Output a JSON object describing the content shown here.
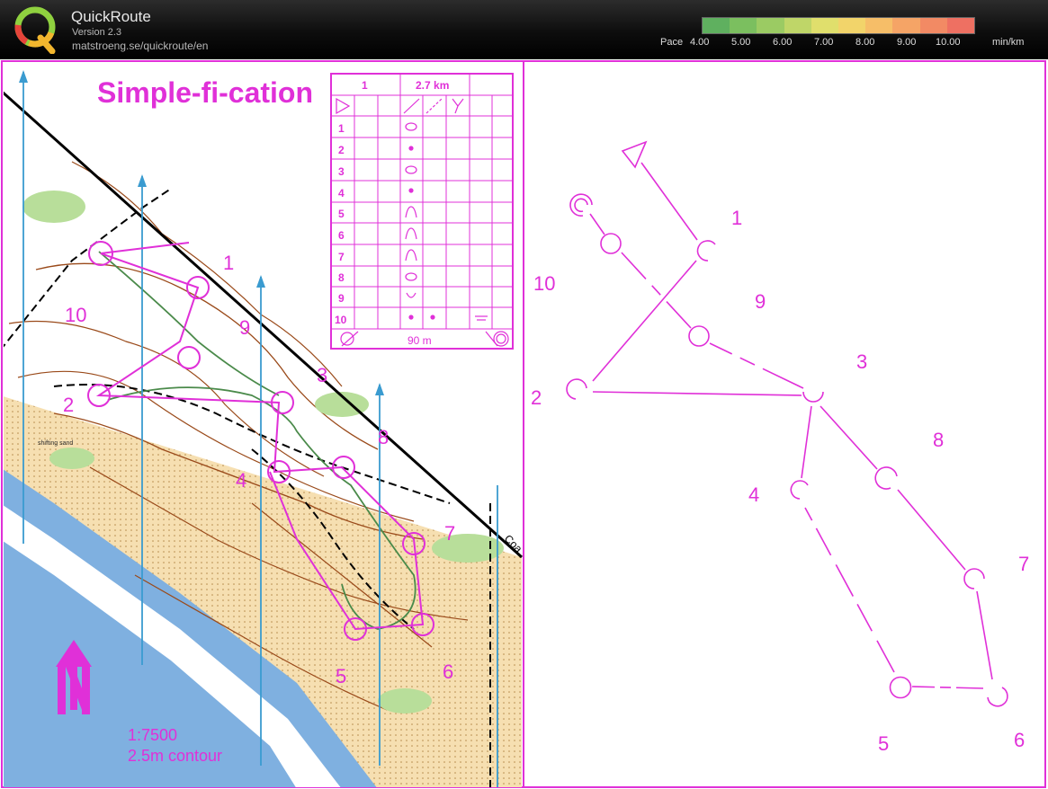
{
  "app": {
    "title": "QuickRoute",
    "version": "Version 2.3",
    "url": "matstroeng.se/quickroute/en"
  },
  "pace_legend": {
    "label": "Pace",
    "ticks": [
      "4.00",
      "5.00",
      "6.00",
      "7.00",
      "8.00",
      "9.00",
      "10.00"
    ],
    "unit": "min/km",
    "colors": [
      "#5fb05f",
      "#7bbf5f",
      "#9bcb63",
      "#bfd668",
      "#e0df6c",
      "#f2d46a",
      "#f6be68",
      "#f5a466",
      "#f28a64",
      "#ee7062"
    ]
  },
  "map": {
    "title": "Simple-fi-cation",
    "scale": "1:7500",
    "contour": "2.5m contour",
    "road_label": "Coa",
    "sand_label": "shifting sand",
    "course_name": "1",
    "course_length": "2.7 km",
    "finish_distance": "90 m",
    "control_numbers": [
      "1",
      "2",
      "3",
      "4",
      "5",
      "6",
      "7",
      "8",
      "9",
      "10"
    ],
    "map_labels": [
      "1",
      "2",
      "3",
      "4",
      "5",
      "6",
      "7",
      "8",
      "9",
      "10"
    ]
  },
  "schematic": {
    "labels": [
      "1",
      "2",
      "3",
      "4",
      "5",
      "6",
      "7",
      "8",
      "9",
      "10"
    ]
  },
  "colors": {
    "course": "#e030d8",
    "meridian": "#3a9bd0",
    "header_bg": "#111111"
  }
}
